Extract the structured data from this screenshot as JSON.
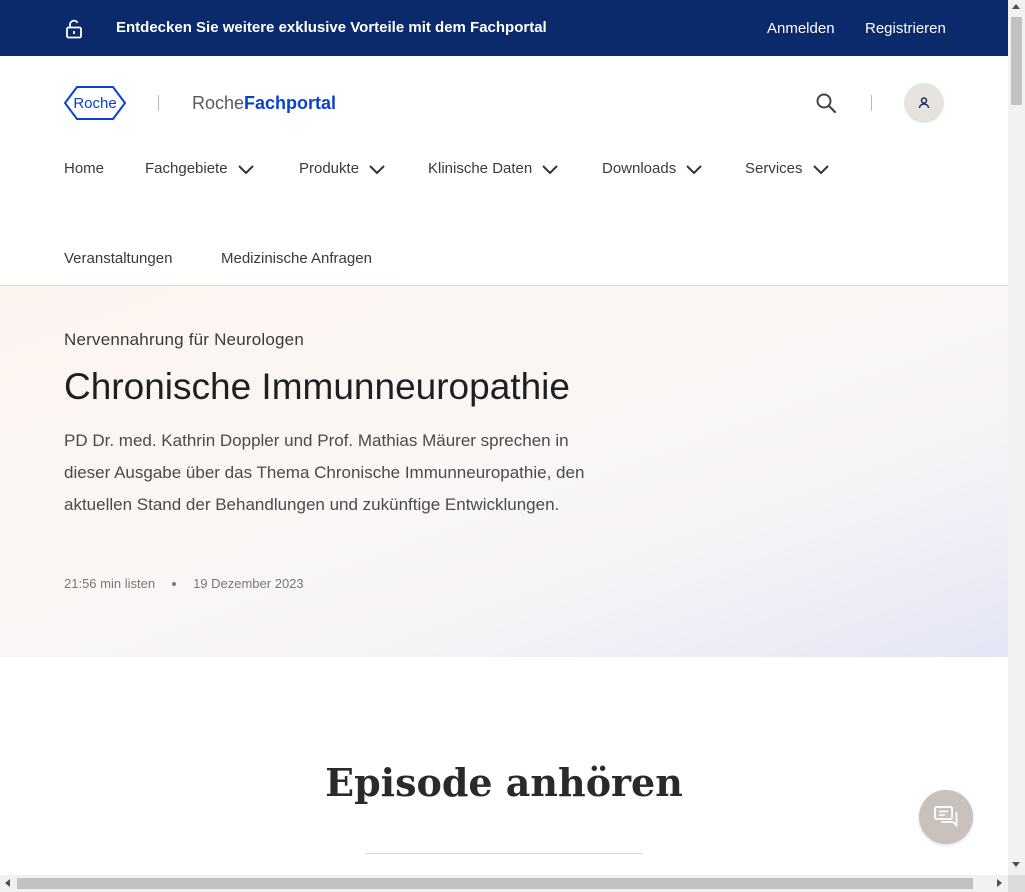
{
  "topbar": {
    "promo_text": "Entdecken Sie weitere exklusive Vorteile mit dem Fachportal",
    "login_label": "Anmelden",
    "register_label": "Registrieren",
    "lock_icon": "unlock-icon"
  },
  "header": {
    "logo_text": "Roche",
    "brand_prefix": "Roche",
    "brand_suffix": "Fachportal",
    "brand_color": "#0b41cd",
    "search_icon": "search-icon",
    "user_icon": "user-icon"
  },
  "nav": {
    "items": [
      {
        "label": "Home",
        "has_dropdown": false
      },
      {
        "label": "Fachgebiete",
        "has_dropdown": true
      },
      {
        "label": "Produkte",
        "has_dropdown": true
      },
      {
        "label": "Klinische Daten",
        "has_dropdown": true
      },
      {
        "label": "Downloads",
        "has_dropdown": true
      },
      {
        "label": "Services",
        "has_dropdown": true
      },
      {
        "label": "Veranstaltungen",
        "has_dropdown": false
      },
      {
        "label": "Medizinische Anfragen",
        "has_dropdown": false
      }
    ]
  },
  "hero": {
    "kicker": "Nervennahrung für Neurologen",
    "title": "Chronische Immunneuropathie",
    "description": "PD Dr. med. Kathrin Doppler und Prof. Mathias Mäurer sprechen in dieser Ausgabe über das Thema Chronische Immunneuropathie, den aktuellen Stand der Behandlungen und zukünftige Entwicklungen.",
    "duration": "21:56 min listen",
    "date": "19 Dezember 2023"
  },
  "episode": {
    "heading": "Episode anhören"
  },
  "chat": {
    "icon": "chat-icon"
  },
  "colors": {
    "topbar_bg": "#0b2a6b",
    "accent": "#0b41cd"
  }
}
